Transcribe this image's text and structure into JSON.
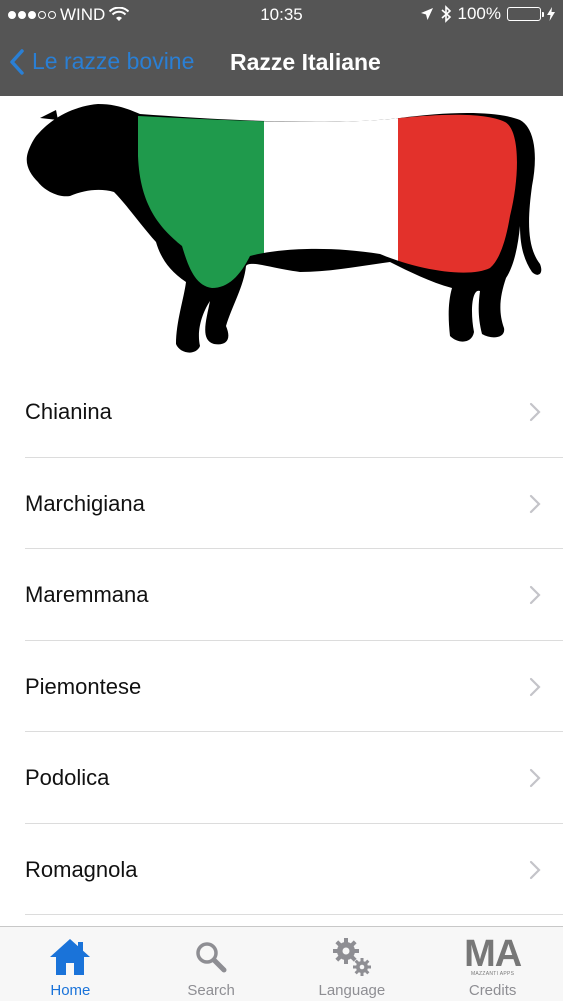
{
  "status_bar": {
    "carrier": "WIND",
    "time": "10:35",
    "battery": "100%",
    "signal_icon": "signal-dots-icon",
    "wifi_icon": "wifi-icon",
    "location_icon": "location-arrow-icon",
    "bluetooth_icon": "bluetooth-icon",
    "battery_level": 1.0,
    "battery_color": "#4cd964"
  },
  "nav": {
    "back_label": "Le razze bovine",
    "title": "Razze Italiane",
    "back_icon": "chevron-left-icon",
    "back_color": "#2a7fd4",
    "bar_color": "#555555"
  },
  "hero": {
    "image": "cow-silhouette-italian-flag",
    "flag_colors": [
      "#1f9a4c",
      "#ffffff",
      "#e3312b"
    ]
  },
  "breeds": [
    {
      "label": "Chianina"
    },
    {
      "label": "Marchigiana"
    },
    {
      "label": "Maremmana"
    },
    {
      "label": "Piemontese"
    },
    {
      "label": "Podolica"
    },
    {
      "label": "Romagnola"
    }
  ],
  "tabs": [
    {
      "label": "Home",
      "icon": "home-icon",
      "active": true
    },
    {
      "label": "Search",
      "icon": "search-icon",
      "active": false
    },
    {
      "label": "Language",
      "icon": "gears-icon",
      "active": false
    },
    {
      "label": "Credits",
      "icon": "mazzanti-apps-logo",
      "active": false,
      "logo_text": "MA",
      "logo_subtext": "MAZZANTI APPS"
    }
  ]
}
